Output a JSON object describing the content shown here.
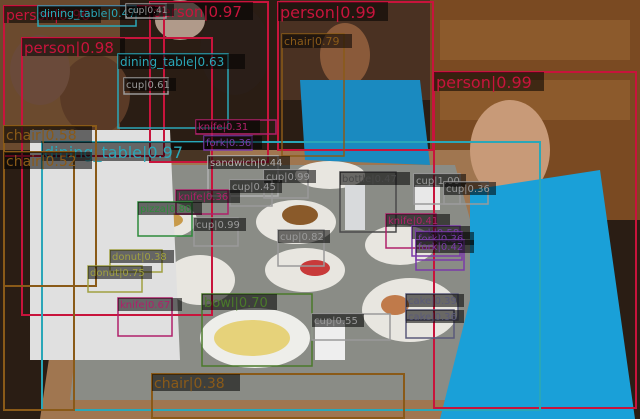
{
  "image": {
    "subject": "restaurant-table-photo"
  },
  "detections": [
    {
      "label": "person|0.99",
      "color": "#c8143c"
    },
    {
      "label": "person|0.99",
      "color": "#c8143c"
    },
    {
      "label": "person|0.98",
      "color": "#c8143c"
    },
    {
      "label": "person|0.97",
      "color": "#c8143c"
    },
    {
      "label": "person|0.96",
      "color": "#c8143c"
    },
    {
      "label": "dining_table|0.97",
      "color": "#2aa7b8"
    },
    {
      "label": "dining_table|0.63",
      "color": "#2aa7b8"
    },
    {
      "label": "dining_table|0.47",
      "color": "#2aa7b8"
    },
    {
      "label": "chair|0.79",
      "color": "#8a5a18"
    },
    {
      "label": "chair|0.58",
      "color": "#8a5a18"
    },
    {
      "label": "chair|0.52",
      "color": "#8a5a18"
    },
    {
      "label": "chair|0.38",
      "color": "#8a5a18"
    },
    {
      "label": "cup|0.41",
      "color": "#9a9a9a"
    },
    {
      "label": "cup|0.61",
      "color": "#9a9a9a"
    },
    {
      "label": "knife|0.31",
      "color": "#b0206a"
    },
    {
      "label": "fork|0.36",
      "color": "#7a3aa8"
    },
    {
      "label": "sandwich|0.44",
      "color": "#b0b0b0"
    },
    {
      "label": "cup|0.99",
      "color": "#9a9a9a"
    },
    {
      "label": "cup|0.45",
      "color": "#9a9a9a"
    },
    {
      "label": "bottle|0.47",
      "color": "#4a4a4a"
    },
    {
      "label": "cup|1.00",
      "color": "#9a9a9a"
    },
    {
      "label": "cup|0.36",
      "color": "#9a9a9a"
    },
    {
      "label": "knife|0.36",
      "color": "#b0206a"
    },
    {
      "label": "pizza|0.80",
      "color": "#2e8b3a"
    },
    {
      "label": "cup|0.99",
      "color": "#9a9a9a"
    },
    {
      "label": "cup|0.82",
      "color": "#9a9a9a"
    },
    {
      "label": "knife|0.41",
      "color": "#b0206a"
    },
    {
      "label": "fork|0.58",
      "color": "#7a3aa8"
    },
    {
      "label": "fork|0.36",
      "color": "#7a3aa8"
    },
    {
      "label": "fork|0.42",
      "color": "#7a3aa8"
    },
    {
      "label": "donut|0.38",
      "color": "#a0a040"
    },
    {
      "label": "donut|0.75",
      "color": "#a0a040"
    },
    {
      "label": "bowl|0.70",
      "color": "#4a7a2a"
    },
    {
      "label": "knife|0.67",
      "color": "#b0206a"
    },
    {
      "label": "cup|0.55",
      "color": "#9a9a9a"
    },
    {
      "label": "cake|0.39",
      "color": "#5a5a7a"
    },
    {
      "label": "cake|0.36",
      "color": "#5a5a7a"
    }
  ]
}
